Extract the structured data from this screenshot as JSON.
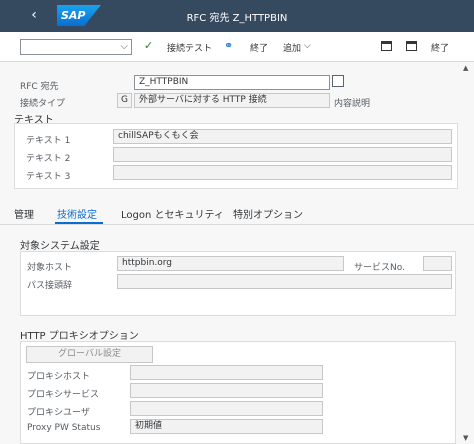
{
  "shell": {
    "back_icon": "‹",
    "logo": "SAP",
    "title": "RFC 宛先 Z_HTTPBIN"
  },
  "toolbar": {
    "command_value": "",
    "dropdown_icon": "⌵",
    "check_icon": "✓",
    "connection_test_label": "接続テスト",
    "glasses_icon": "⚭",
    "exit_label": "終了",
    "more_label": "追加",
    "more_chevron": "⌵",
    "exit2_label": "終了"
  },
  "header": {
    "dest_label": "RFC 宛先",
    "dest_value": "Z_HTTPBIN",
    "conn_type_label": "接続タイプ",
    "conn_type_code": "G",
    "conn_type_desc": "外部サーバに対する HTTP 接続",
    "desc_label": "内容説明"
  },
  "texts": {
    "section_label": "テキスト",
    "text1_label": "テキスト 1",
    "text1_value": "chillSAPもくもく会",
    "text2_label": "テキスト 2",
    "text2_value": "",
    "text3_label": "テキスト 3",
    "text3_value": ""
  },
  "tabs": [
    {
      "label": "管理"
    },
    {
      "label": "技術設定"
    },
    {
      "label": "Logon とセキュリティ"
    },
    {
      "label": "特別オプション"
    }
  ],
  "target_system": {
    "section_label": "対象システム設定",
    "host_label": "対象ホスト",
    "host_value": "httpbin.org",
    "service_label": "サービスNo.",
    "service_value": "",
    "path_label": "パス接頭辞",
    "path_value": ""
  },
  "proxy": {
    "section_label": "HTTP プロキシオプション",
    "global_button": "グローバル設定",
    "host_label": "プロキシホスト",
    "service_label": "プロキシサービス",
    "user_label": "プロキシユーザ",
    "pw_status_label": "Proxy PW Status",
    "pw_status_value": "初期値"
  },
  "scroll": {
    "up_icon": "▲",
    "down_icon": "▼"
  }
}
